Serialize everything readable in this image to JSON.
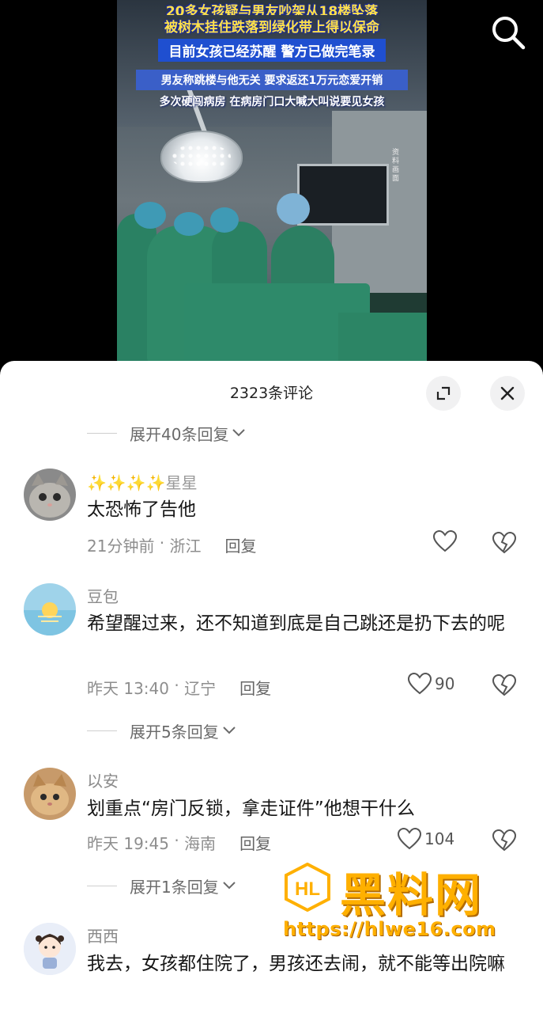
{
  "video": {
    "captions": [
      "20多女孩疑与男友吵架从18楼坠落",
      "被树木挂住跌落到绿化带上得以保命",
      "目前女孩已经苏醒 警方已做完笔录",
      "男友称跳楼与他无关 要求返还1万元恋爱开销",
      "多次硬闯病房 在病房门口大喊大叫说要见女孩"
    ],
    "side_label": "资料画面"
  },
  "comments_header": {
    "title": "2323条评论"
  },
  "expand_replies": [
    "展开40条回复",
    "展开5条回复",
    "展开1条回复"
  ],
  "comments": [
    {
      "name": "✨✨✨✨星星",
      "text": "太恐怖了告他",
      "time": "21分钟前",
      "location": "浙江",
      "reply_label": "回复",
      "likes": ""
    },
    {
      "name": "豆包",
      "text": "希望醒过来，还不知道到底是自己跳还是扔下去的呢",
      "time": "昨天 13:40",
      "location": "辽宁",
      "reply_label": "回复",
      "likes": "90"
    },
    {
      "name": "以安",
      "text": "划重点“房门反锁，拿走证件”他想干什么",
      "time": "昨天 19:45",
      "location": "海南",
      "reply_label": "回复",
      "likes": "104"
    },
    {
      "name": "西西",
      "text": "我去，女孩都住院了，男孩还去闹，就不能等出院嘛",
      "time": "",
      "location": "",
      "reply_label": "",
      "likes": ""
    }
  ],
  "watermark": {
    "name": "黑料网",
    "url": "https://hlwe16.com"
  },
  "colors": {
    "accent_watermark": "#ffb000",
    "sheet_bg": "#ffffff",
    "muted_text": "#8e8e8e"
  },
  "icons": [
    "search-icon",
    "expand-icon",
    "close-icon",
    "chevron-down-icon",
    "heart-icon",
    "broken-heart-icon"
  ]
}
